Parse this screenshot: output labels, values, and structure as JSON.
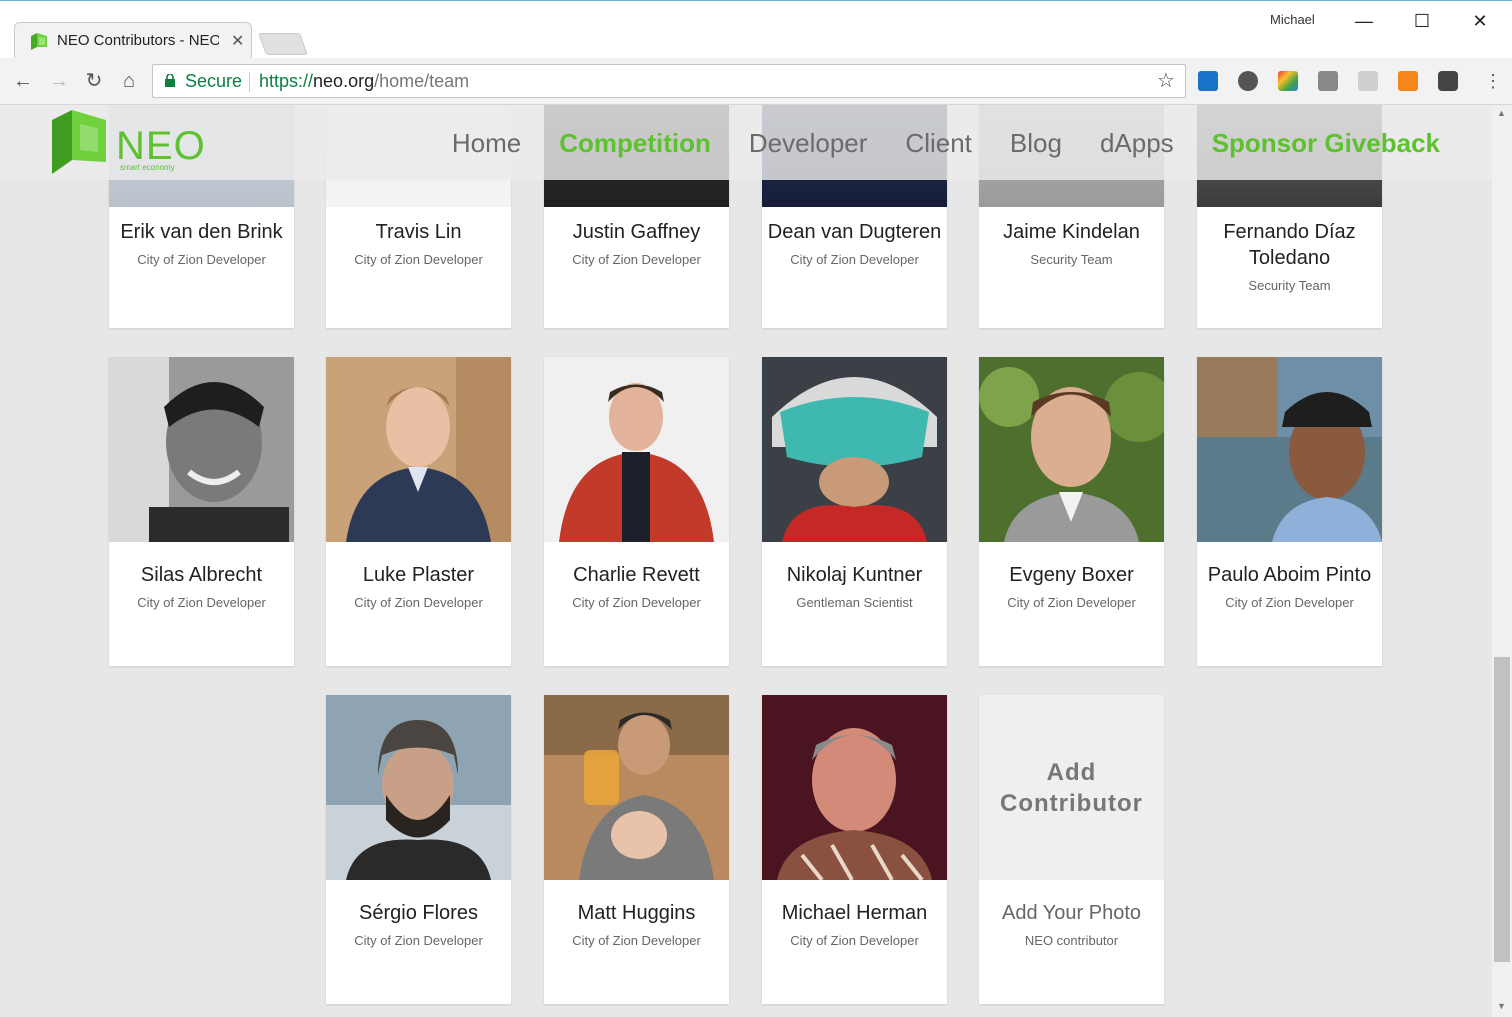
{
  "browser": {
    "tab_title": "NEO Contributors - NEO",
    "profile_name": "Michael",
    "secure_label": "Secure",
    "url_scheme": "https://",
    "url_host": "neo.org",
    "url_path": "/home/team"
  },
  "site": {
    "logo_text": "NEO",
    "logo_tagline": "smart economy",
    "brand_color": "#5ec12f",
    "nav": [
      "Home",
      "Competition",
      "Developer",
      "Client",
      "Blog",
      "dApps",
      "Sponsor Giveback"
    ]
  },
  "team": {
    "row1": [
      {
        "name": "Erik van den Brink",
        "role": "City of Zion Developer"
      },
      {
        "name": "Travis Lin",
        "role": "City of Zion Developer"
      },
      {
        "name": "Justin Gaffney",
        "role": "City of Zion Developer"
      },
      {
        "name": "Dean van Dugteren",
        "role": "City of Zion Developer"
      },
      {
        "name": "Jaime Kindelan",
        "role": "Security Team"
      },
      {
        "name": "Fernando Díaz Toledano",
        "role": "Security Team"
      }
    ],
    "row2": [
      {
        "name": "Silas Albrecht",
        "role": "City of Zion Developer"
      },
      {
        "name": "Luke Plaster",
        "role": "City of Zion Developer"
      },
      {
        "name": "Charlie Revett",
        "role": "City of Zion Developer"
      },
      {
        "name": "Nikolaj Kuntner",
        "role": "Gentleman Scientist"
      },
      {
        "name": "Evgeny Boxer",
        "role": "City of Zion Developer"
      },
      {
        "name": "Paulo Aboim Pinto",
        "role": "City of Zion Developer"
      }
    ],
    "row3": [
      {
        "name": "Sérgio Flores",
        "role": "City of Zion Developer"
      },
      {
        "name": "Matt Huggins",
        "role": "City of Zion Developer"
      },
      {
        "name": "Michael Herman",
        "role": "City of Zion Developer"
      }
    ],
    "add_card": {
      "box_label": "Add Contributor",
      "name": "Add Your Photo",
      "role": "NEO contributor"
    }
  }
}
